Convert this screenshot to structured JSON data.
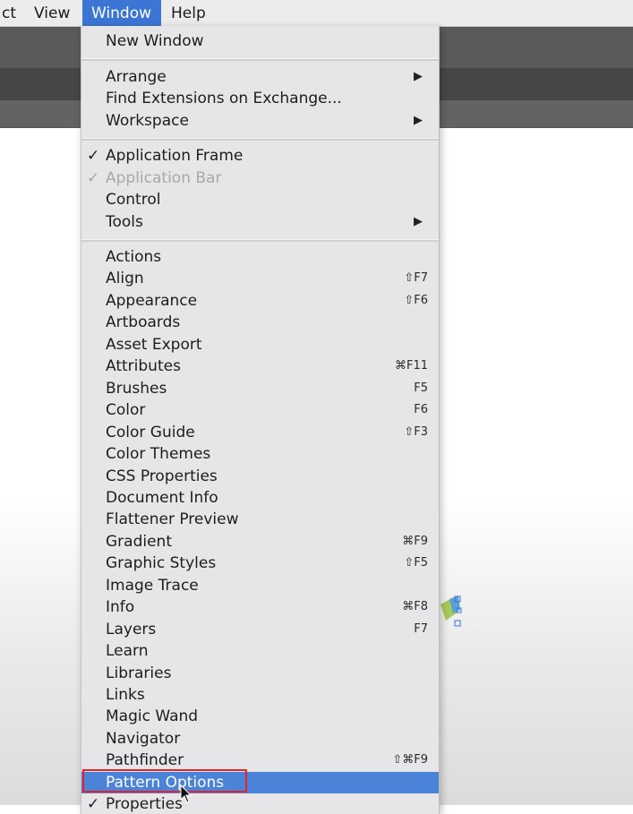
{
  "menubar": {
    "items": [
      {
        "label": "ct"
      },
      {
        "label": "View"
      },
      {
        "label": "Window"
      },
      {
        "label": "Help"
      }
    ]
  },
  "menu": {
    "new_window": "New Window",
    "arrange": "Arrange",
    "find_extensions": "Find Extensions on Exchange...",
    "workspace": "Workspace",
    "application_frame": "Application Frame",
    "application_bar": "Application Bar",
    "control": "Control",
    "tools": "Tools",
    "panels": [
      {
        "label": "Actions",
        "shortcut": ""
      },
      {
        "label": "Align",
        "shortcut": "⇧F7"
      },
      {
        "label": "Appearance",
        "shortcut": "⇧F6"
      },
      {
        "label": "Artboards",
        "shortcut": ""
      },
      {
        "label": "Asset Export",
        "shortcut": ""
      },
      {
        "label": "Attributes",
        "shortcut": "⌘F11"
      },
      {
        "label": "Brushes",
        "shortcut": "F5"
      },
      {
        "label": "Color",
        "shortcut": "F6"
      },
      {
        "label": "Color Guide",
        "shortcut": "⇧F3"
      },
      {
        "label": "Color Themes",
        "shortcut": ""
      },
      {
        "label": "CSS Properties",
        "shortcut": ""
      },
      {
        "label": "Document Info",
        "shortcut": ""
      },
      {
        "label": "Flattener Preview",
        "shortcut": ""
      },
      {
        "label": "Gradient",
        "shortcut": "⌘F9"
      },
      {
        "label": "Graphic Styles",
        "shortcut": "⇧F5"
      },
      {
        "label": "Image Trace",
        "shortcut": ""
      },
      {
        "label": "Info",
        "shortcut": "⌘F8"
      },
      {
        "label": "Layers",
        "shortcut": "F7"
      },
      {
        "label": "Learn",
        "shortcut": ""
      },
      {
        "label": "Libraries",
        "shortcut": ""
      },
      {
        "label": "Links",
        "shortcut": ""
      },
      {
        "label": "Magic Wand",
        "shortcut": ""
      },
      {
        "label": "Navigator",
        "shortcut": ""
      },
      {
        "label": "Pathfinder",
        "shortcut": "⇧⌘F9"
      },
      {
        "label": "Pattern Options",
        "shortcut": ""
      },
      {
        "label": "Properties",
        "shortcut": ""
      }
    ],
    "check_glyph": "✓",
    "submenu_glyph": "▶"
  },
  "colors": {
    "highlight": "#4a83d8",
    "callout": "#e0262a"
  }
}
